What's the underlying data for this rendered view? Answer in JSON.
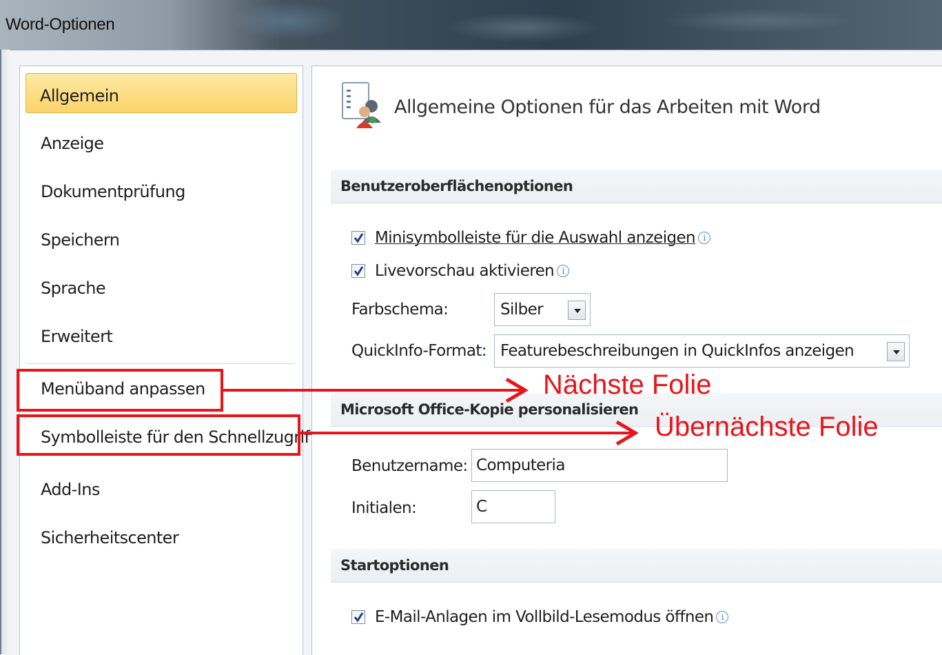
{
  "window": {
    "title": "Word-Optionen"
  },
  "nav": {
    "items": [
      {
        "label": "Allgemein",
        "selected": true
      },
      {
        "label": "Anzeige"
      },
      {
        "label": "Dokumentprüfung"
      },
      {
        "label": "Speichern"
      },
      {
        "label": "Sprache"
      },
      {
        "label": "Erweitert"
      },
      {
        "label": "Menüband anpassen"
      },
      {
        "label": "Symbolleiste für den Schnellzugriff"
      },
      {
        "label": "Add-Ins"
      },
      {
        "label": "Sicherheitscenter"
      }
    ]
  },
  "main": {
    "header": "Allgemeine Optionen für das Arbeiten mit Word",
    "header_icon": "general-options-icon",
    "sections": {
      "ui": {
        "title": "Benutzeroberflächenoptionen",
        "minitoolbar": {
          "label": "Minisymbolleiste für die Auswahl anzeigen",
          "checked": true
        },
        "livepreview": {
          "label": "Livevorschau aktivieren",
          "checked": true
        },
        "colorscheme": {
          "label": "Farbschema:",
          "value": "Silber"
        },
        "quickinfo": {
          "label": "QuickInfo-Format:",
          "value": "Featurebeschreibungen in QuickInfos anzeigen"
        }
      },
      "personalize": {
        "title": "Microsoft Office-Kopie personalisieren",
        "username": {
          "label": "Benutzername:",
          "value": "Computeria"
        },
        "initials": {
          "label": "Initialen:",
          "value": "C"
        }
      },
      "startup": {
        "title": "Startoptionen",
        "email_fullscreen": {
          "label": "E-Mail-Anlagen im Vollbild-Lesemodus öffnen",
          "checked": true
        }
      }
    }
  },
  "annotations": {
    "next_slide": "Nächste Folie",
    "slide_after_next": "Übernächste Folie",
    "color": "#e8141a"
  },
  "colors": {
    "selected_bg": "#fbd46a",
    "info_icon": "#3b78c9"
  }
}
